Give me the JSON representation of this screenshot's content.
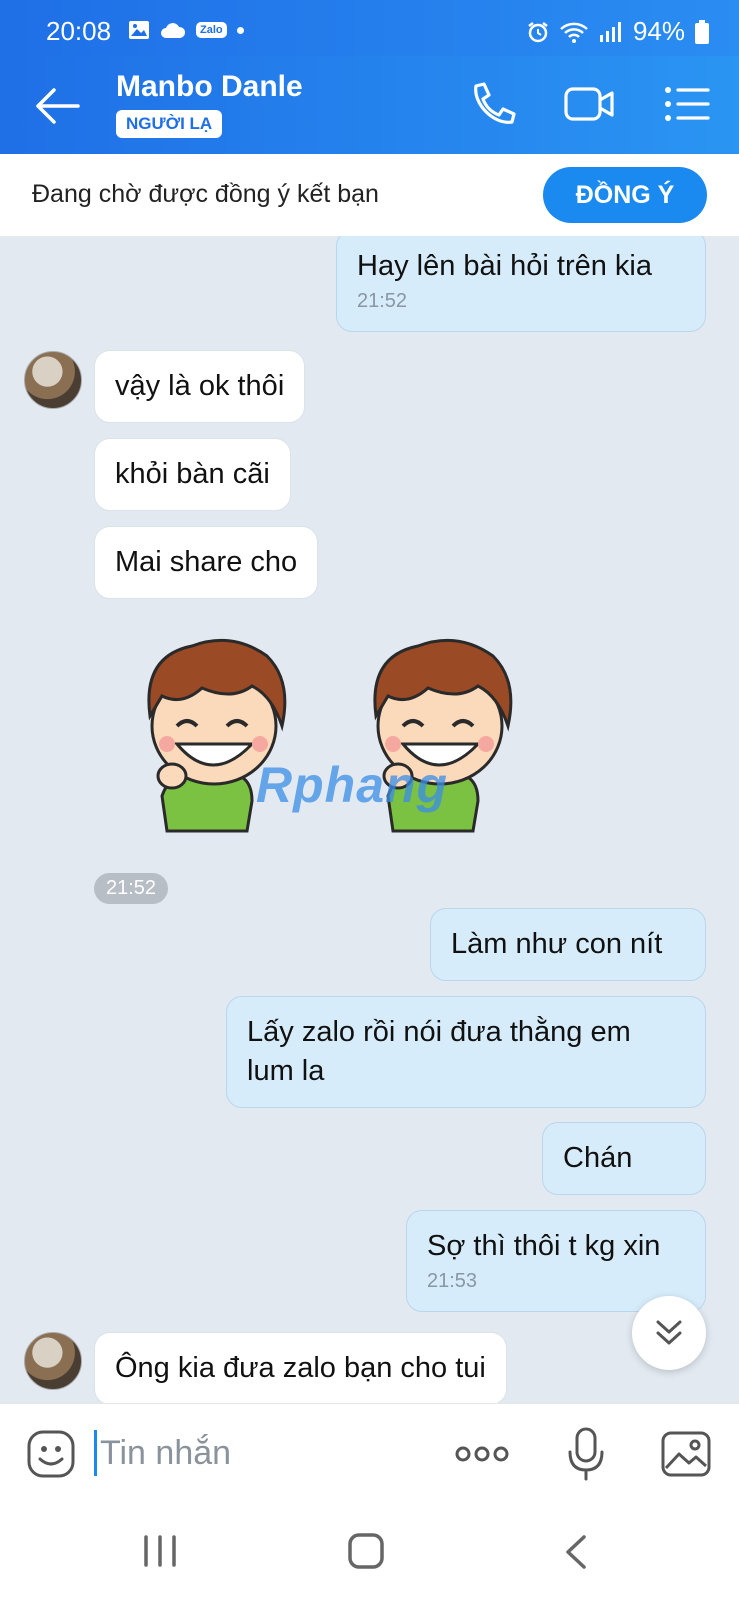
{
  "status_bar": {
    "time": "20:08",
    "zalo_badge": "Zalo",
    "battery": "94%"
  },
  "header": {
    "contact_name": "Manbo Danle",
    "stranger_badge": "NGƯỜI LẠ"
  },
  "friend_request": {
    "text": "Đang chờ được đồng ý kết bạn",
    "accept_label": "ĐỒNG Ý"
  },
  "messages": [
    {
      "side": "out",
      "text": "Hay lên bài hỏi trên kia",
      "time": "21:52"
    },
    {
      "side": "in",
      "text": "vậy là ok thôi"
    },
    {
      "side": "in",
      "text": "khỏi bàn cãi"
    },
    {
      "side": "in",
      "text": "Mai share cho"
    },
    {
      "side": "in",
      "type": "sticker"
    },
    {
      "side": "in",
      "type": "sticker"
    },
    {
      "side": "out",
      "text": "Làm như con nít"
    },
    {
      "side": "out",
      "text": "Lấy zalo rồi nói đưa thằng em lum la"
    },
    {
      "side": "out",
      "text": "Chán"
    },
    {
      "side": "out",
      "text": "Sợ thì thôi t kg xin",
      "time": "21:53"
    },
    {
      "side": "in",
      "text": "Ông kia đưa zalo bạn cho tui"
    }
  ],
  "sticker_time": "21:52",
  "watermark": "Rphang",
  "input": {
    "placeholder": "Tin nhắn"
  },
  "colors": {
    "header_blue": "#1f6fe6",
    "accent_blue": "#1a8af0",
    "outgoing_bubble": "#d6ecfa",
    "incoming_bubble": "#ffffff",
    "chat_bg": "#e2e9f1"
  },
  "icons": [
    "back-arrow-icon",
    "phone-icon",
    "video-camera-icon",
    "menu-list-icon",
    "emoji-icon",
    "more-dots-icon",
    "microphone-icon",
    "image-icon",
    "double-chevron-down-icon"
  ]
}
